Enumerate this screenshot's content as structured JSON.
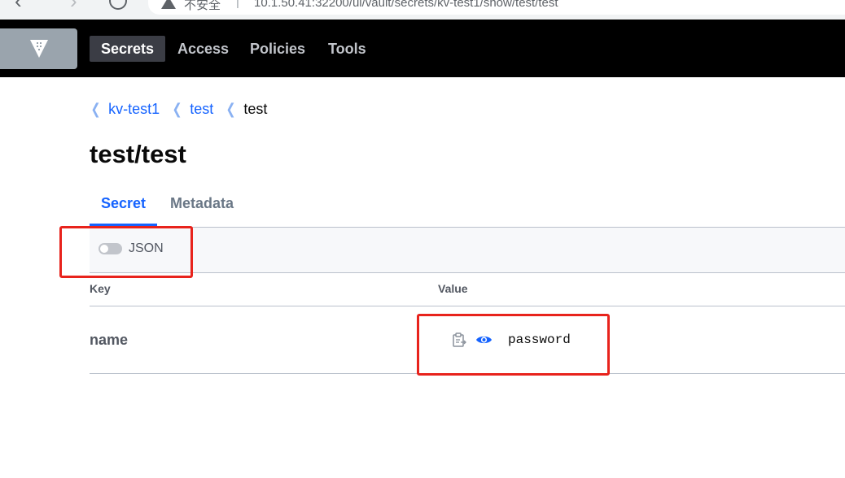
{
  "browser": {
    "security_label": "不安全",
    "separator": "|",
    "url": "10.1.50.41:32200/ui/vault/secrets/kv-test1/show/test/test"
  },
  "header": {
    "nav": [
      {
        "label": "Secrets",
        "active": true
      },
      {
        "label": "Access",
        "active": false
      },
      {
        "label": "Policies",
        "active": false
      },
      {
        "label": "Tools",
        "active": false
      }
    ]
  },
  "breadcrumb": [
    {
      "label": "kv-test1",
      "link": true
    },
    {
      "label": "test",
      "link": true
    },
    {
      "label": "test",
      "link": false
    }
  ],
  "page_title": "test/test",
  "tabs": [
    {
      "label": "Secret",
      "active": true
    },
    {
      "label": "Metadata",
      "active": false
    }
  ],
  "toolbar": {
    "json_toggle_label": "JSON",
    "json_toggle_on": false
  },
  "table": {
    "columns": [
      "Key",
      "Value"
    ],
    "rows": [
      {
        "key": "name",
        "value": "password"
      }
    ]
  },
  "icons": {
    "logo": "vault-logo-icon",
    "copy": "clipboard-copy-icon",
    "reveal": "eye-icon"
  },
  "colors": {
    "accent": "#1563ff",
    "header_bg": "#000000",
    "annotation": "#e8231c"
  }
}
